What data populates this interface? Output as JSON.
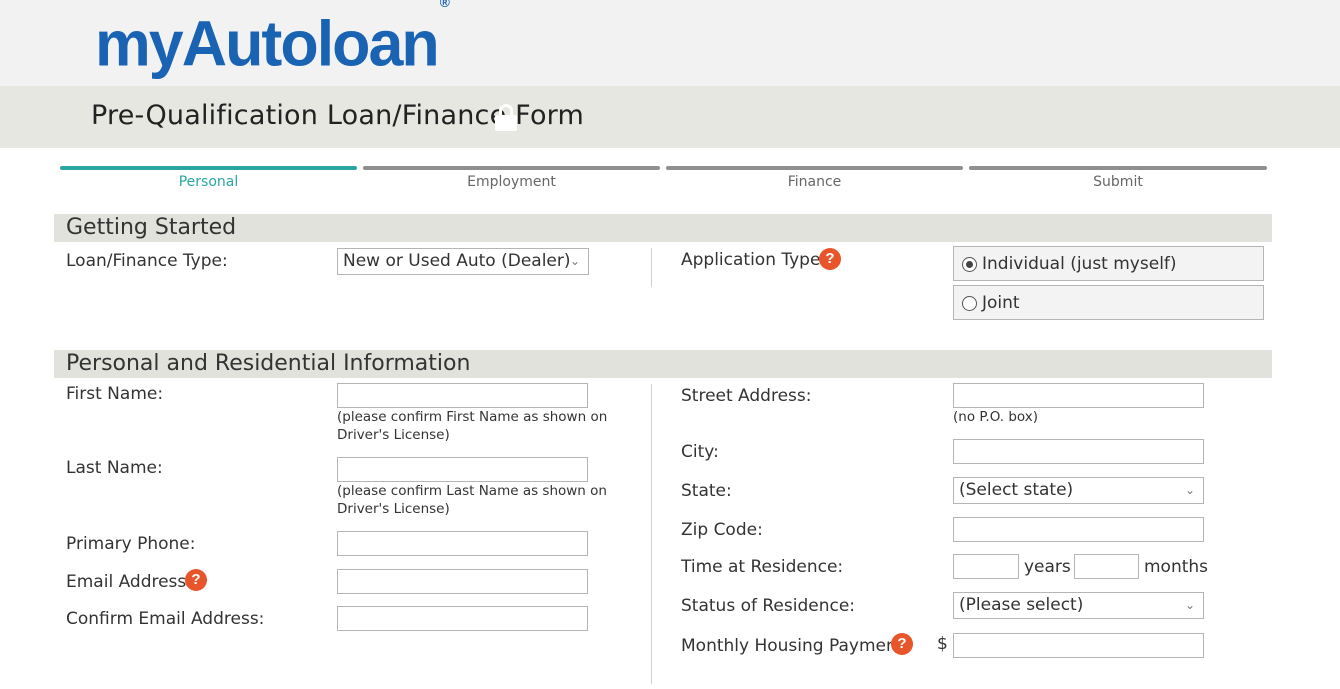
{
  "brand": {
    "name": "myAutoloan",
    "registered": "®",
    "color": "#1a63b3"
  },
  "page": {
    "title": "Pre-Qualification Loan/Finance Form",
    "lock_icon": "lock-icon"
  },
  "steps": [
    {
      "label": "Personal",
      "active": true
    },
    {
      "label": "Employment",
      "active": false
    },
    {
      "label": "Finance",
      "active": false
    },
    {
      "label": "Submit",
      "active": false
    }
  ],
  "colors": {
    "accent": "#2aa6a0",
    "help": "#e8552a",
    "inactive_step": "#8f8f8f"
  },
  "getting_started": {
    "heading": "Getting Started",
    "loan_type_label": "Loan/Finance Type:",
    "loan_type_value": "New or Used Auto (Dealer)",
    "application_type_label": "Application Type:",
    "application_options": [
      {
        "label": "Individual (just myself)",
        "checked": true
      },
      {
        "label": "Joint",
        "checked": false
      }
    ]
  },
  "personal": {
    "heading": "Personal and Residential Information",
    "first_name_label": "First Name:",
    "first_name_note": "(please confirm First Name as shown on Driver's License)",
    "last_name_label": "Last Name:",
    "last_name_note": "(please confirm Last Name as shown on Driver's License)",
    "phone_label": "Primary Phone:",
    "email_label": "Email Address:",
    "confirm_email_label": "Confirm Email Address:",
    "street_label": "Street Address:",
    "street_note": "(no P.O. box)",
    "city_label": "City:",
    "state_label": "State:",
    "state_value": "(Select state)",
    "zip_label": "Zip Code:",
    "time_label": "Time at Residence:",
    "years_label": "years",
    "months_label": "months",
    "status_label": "Status of Residence:",
    "status_value": "(Please select)",
    "payment_label": "Monthly Housing Payment:",
    "currency": "$"
  }
}
